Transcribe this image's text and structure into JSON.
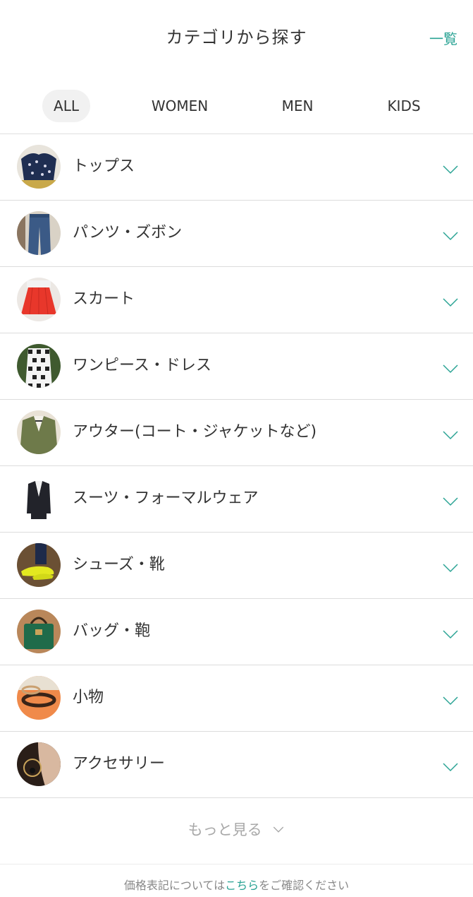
{
  "header": {
    "title": "カテゴリから探す",
    "list_link": "一覧"
  },
  "tabs": [
    {
      "label": "ALL",
      "active": true
    },
    {
      "label": "WOMEN",
      "active": false
    },
    {
      "label": "MEN",
      "active": false
    },
    {
      "label": "KIDS",
      "active": false
    }
  ],
  "categories": [
    {
      "label": "トップス",
      "icon": "tops-photo"
    },
    {
      "label": "パンツ・ズボン",
      "icon": "pants-photo"
    },
    {
      "label": "スカート",
      "icon": "skirt-photo"
    },
    {
      "label": "ワンピース・ドレス",
      "icon": "dress-photo"
    },
    {
      "label": "アウター(コート・ジャケットなど)",
      "icon": "outer-photo"
    },
    {
      "label": "スーツ・フォーマルウェア",
      "icon": "suit-photo"
    },
    {
      "label": "シューズ・靴",
      "icon": "shoes-photo"
    },
    {
      "label": "バッグ・鞄",
      "icon": "bag-photo"
    },
    {
      "label": "小物",
      "icon": "accessories-small-photo"
    },
    {
      "label": "アクセサリー",
      "icon": "jewelry-photo"
    }
  ],
  "more": {
    "label": "もっと見る"
  },
  "footer": {
    "prefix": "価格表記については",
    "link": "こちら",
    "suffix": "をご確認ください"
  },
  "colors": {
    "accent": "#2aa394",
    "text": "#333333",
    "muted": "#a8a8a8",
    "tab_active_bg": "#f1f1f1",
    "divider": "#dcdcdc"
  }
}
